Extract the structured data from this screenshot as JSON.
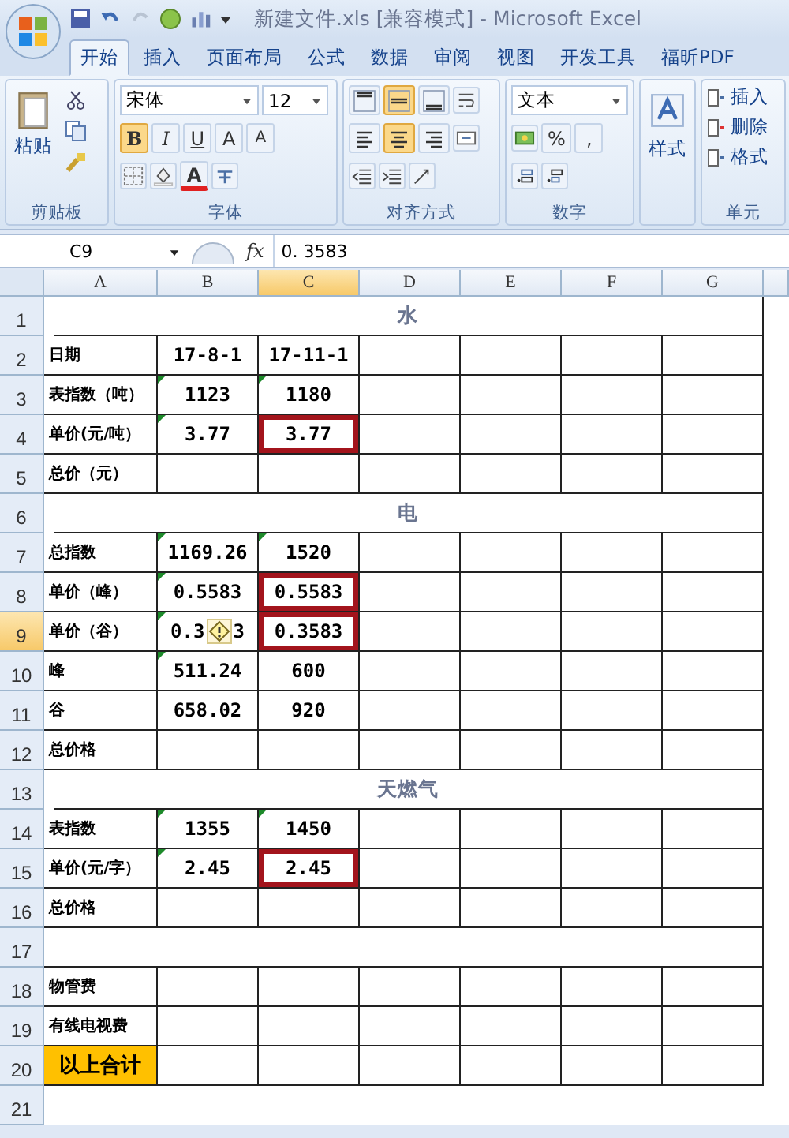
{
  "title_bar": {
    "title": "新建文件.xls  [兼容模式] - Microsoft Excel"
  },
  "tabs": [
    {
      "label": "开始",
      "selected": true
    },
    {
      "label": "插入",
      "selected": false
    },
    {
      "label": "页面布局",
      "selected": false
    },
    {
      "label": "公式",
      "selected": false
    },
    {
      "label": "数据",
      "selected": false
    },
    {
      "label": "审阅",
      "selected": false
    },
    {
      "label": "视图",
      "selected": false
    },
    {
      "label": "开发工具",
      "selected": false
    },
    {
      "label": "福昕PDF",
      "selected": false
    }
  ],
  "ribbon": {
    "clipboard": {
      "paste": "粘贴",
      "label": "剪贴板"
    },
    "font": {
      "label": "字体",
      "name": "宋体",
      "size": "12",
      "buttons": [
        {
          "kind": "bold",
          "text": "B",
          "pressed": true
        },
        {
          "kind": "italic",
          "text": "I",
          "pressed": false
        },
        {
          "kind": "underline",
          "text": "U",
          "pressed": false
        },
        {
          "kind": "grow",
          "text": "A",
          "pressed": false
        },
        {
          "kind": "shrink",
          "text": "A",
          "pressed": false
        }
      ],
      "font_color": "A"
    },
    "alignment": {
      "label": "对齐方式",
      "vertical": [
        {
          "selected": false
        },
        {
          "selected": true
        },
        {
          "selected": false
        }
      ],
      "horizontal": [
        {
          "selected": false
        },
        {
          "selected": true
        },
        {
          "selected": false
        }
      ]
    },
    "number": {
      "label": "数字",
      "format": "文本",
      "percent": "%",
      "comma": ","
    },
    "styles": {
      "button": "样式"
    },
    "cells": {
      "label": "单元",
      "buttons": [
        "插入",
        "删除",
        "格式"
      ]
    }
  },
  "formula_bar": {
    "name_box": "C9",
    "function_label": "fx",
    "value": "0. 3583"
  },
  "sheet": {
    "columns": [
      {
        "label": "A",
        "selected": false
      },
      {
        "label": "B",
        "selected": false
      },
      {
        "label": "C",
        "selected": true
      },
      {
        "label": "D",
        "selected": false
      },
      {
        "label": "E",
        "selected": false
      },
      {
        "label": "F",
        "selected": false
      },
      {
        "label": "G",
        "selected": false
      }
    ],
    "rows": [
      {
        "label": "1",
        "selected": false,
        "kind": "title",
        "text": "水"
      },
      {
        "label": "2",
        "selected": false,
        "kind": "data",
        "cells": [
          {
            "kind": "label",
            "text": "日期"
          },
          {
            "kind": "value",
            "text": "17-8-1"
          },
          {
            "kind": "value",
            "text": "17-11-1"
          }
        ]
      },
      {
        "label": "3",
        "selected": false,
        "kind": "data",
        "cells": [
          {
            "kind": "label",
            "text": "表指数（吨）"
          },
          {
            "kind": "value",
            "text": "1123",
            "flag": true
          },
          {
            "kind": "value",
            "text": "1180",
            "flag": true
          }
        ]
      },
      {
        "label": "4",
        "selected": false,
        "kind": "data",
        "cells": [
          {
            "kind": "label",
            "text": "单价(元/吨）"
          },
          {
            "kind": "value",
            "text": "3.77",
            "flag": true
          },
          {
            "kind": "value",
            "text": "3.77",
            "highlighted": true
          }
        ]
      },
      {
        "label": "5",
        "selected": false,
        "kind": "data",
        "cells": [
          {
            "kind": "label",
            "text": "总价（元）"
          }
        ]
      },
      {
        "label": "6",
        "selected": false,
        "kind": "title",
        "text": "电"
      },
      {
        "label": "7",
        "selected": false,
        "kind": "data",
        "cells": [
          {
            "kind": "label",
            "text": "总指数"
          },
          {
            "kind": "value",
            "text": "1169.26",
            "flag": true
          },
          {
            "kind": "value",
            "text": "1520",
            "flag": true
          }
        ]
      },
      {
        "label": "8",
        "selected": false,
        "kind": "data",
        "cells": [
          {
            "kind": "label",
            "text": "单价（峰）"
          },
          {
            "kind": "value",
            "text": "0.5583",
            "flag": true
          },
          {
            "kind": "value",
            "text": "0.5583",
            "highlighted": true
          }
        ]
      },
      {
        "label": "9",
        "selected": true,
        "kind": "data",
        "cells": [
          {
            "kind": "label",
            "text": "单价（谷）"
          },
          {
            "kind": "value",
            "text": "0.3",
            "text_after": "3",
            "warning": true,
            "flag": true
          },
          {
            "kind": "value",
            "text": "0.3583",
            "highlighted": true
          }
        ]
      },
      {
        "label": "10",
        "selected": false,
        "kind": "data",
        "cells": [
          {
            "kind": "label",
            "text": "峰"
          },
          {
            "kind": "value",
            "text": "511.24",
            "flag": true
          },
          {
            "kind": "value",
            "text": "600"
          }
        ]
      },
      {
        "label": "11",
        "selected": false,
        "kind": "data",
        "cells": [
          {
            "kind": "label",
            "text": "谷"
          },
          {
            "kind": "value",
            "text": "658.02"
          },
          {
            "kind": "value",
            "text": "920"
          }
        ]
      },
      {
        "label": "12",
        "selected": false,
        "kind": "data",
        "cells": [
          {
            "kind": "label",
            "text": "总价格"
          }
        ]
      },
      {
        "label": "13",
        "selected": false,
        "kind": "title",
        "text": "天燃气"
      },
      {
        "label": "14",
        "selected": false,
        "kind": "data",
        "cells": [
          {
            "kind": "label",
            "text": "表指数"
          },
          {
            "kind": "value",
            "text": "1355",
            "flag": true
          },
          {
            "kind": "value",
            "text": "1450",
            "flag": true
          }
        ]
      },
      {
        "label": "15",
        "selected": false,
        "kind": "data",
        "cells": [
          {
            "kind": "label",
            "text": "单价(元/字）"
          },
          {
            "kind": "value",
            "text": "2.45",
            "flag": true
          },
          {
            "kind": "value",
            "text": "2.45",
            "highlighted": true
          }
        ]
      },
      {
        "label": "16",
        "selected": false,
        "kind": "data",
        "cells": [
          {
            "kind": "label",
            "text": "总价格"
          }
        ]
      },
      {
        "label": "17",
        "selected": false,
        "kind": "blank"
      },
      {
        "label": "18",
        "selected": false,
        "kind": "data",
        "cells": [
          {
            "kind": "label",
            "text": "物管费"
          }
        ]
      },
      {
        "label": "19",
        "selected": false,
        "kind": "data",
        "cells": [
          {
            "kind": "label",
            "text": "有线电视费"
          }
        ]
      },
      {
        "label": "20",
        "selected": false,
        "kind": "data",
        "cells": [
          {
            "kind": "total",
            "text": "以上合计"
          }
        ]
      },
      {
        "label": "21",
        "selected": false,
        "kind": "open"
      }
    ]
  }
}
